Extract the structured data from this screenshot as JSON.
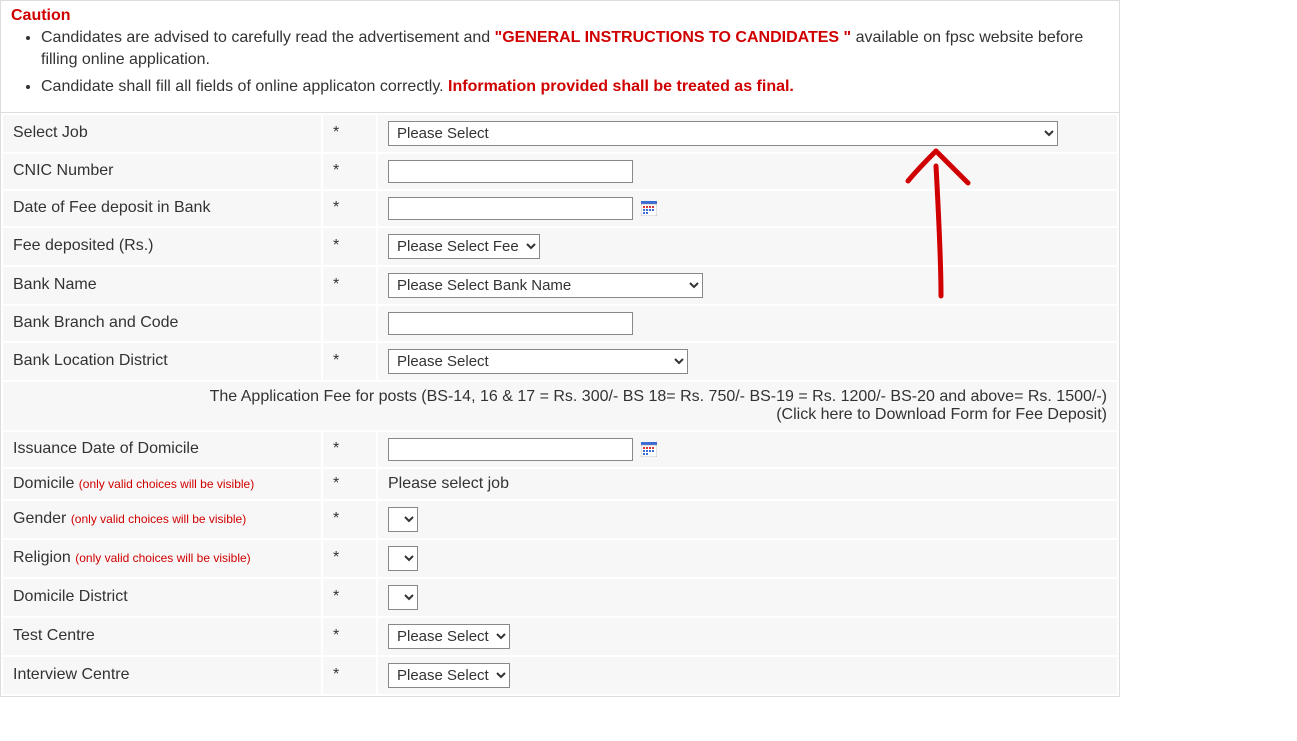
{
  "caution": {
    "title": "Caution",
    "item1_pre": "Candidates are advised to carefully read the advertisement and ",
    "item1_strong": "\"GENERAL INSTRUCTIONS TO CANDIDATES \"",
    "item1_post": " available on fpsc website before filling online application.",
    "item2_pre": "Candidate shall fill all fields of online applicaton correctly. ",
    "item2_strong": "Information provided shall be treated as final."
  },
  "fields": {
    "select_job": {
      "label": "Select Job",
      "star": "*",
      "option": "Please Select"
    },
    "cnic": {
      "label": "CNIC Number",
      "star": "*",
      "value": ""
    },
    "fee_date": {
      "label": "Date of Fee deposit in Bank",
      "star": "*",
      "value": ""
    },
    "fee_amount": {
      "label": "Fee deposited (Rs.)",
      "star": "*",
      "option": "Please Select Fee"
    },
    "bank_name": {
      "label": "Bank Name",
      "star": "*",
      "option": "Please Select Bank Name"
    },
    "bank_branch": {
      "label": "Bank Branch and Code",
      "star": "",
      "value": ""
    },
    "bank_loc": {
      "label": "Bank Location District",
      "star": "*",
      "option": "Please Select"
    },
    "fee_note_line1": "The Application Fee for posts (BS-14, 16 & 17 = Rs. 300/- BS 18= Rs. 750/- BS-19 = Rs. 1200/- BS-20 and above= Rs. 1500/-)",
    "fee_note_line2": "(Click here to Download Form for Fee Deposit)",
    "domicile_date": {
      "label": "Issuance Date of Domicile",
      "star": "*",
      "value": ""
    },
    "domicile": {
      "label": "Domicile ",
      "note": "(only valid choices will be visible)",
      "star": "*",
      "text": "Please select job"
    },
    "gender": {
      "label": "Gender ",
      "note": "(only valid choices will be visible)",
      "star": "*"
    },
    "religion": {
      "label": "Religion ",
      "note": "(only valid choices will be visible)",
      "star": "*"
    },
    "domicile_district": {
      "label": "Domicile District",
      "star": "*"
    },
    "test_centre": {
      "label": "Test Centre",
      "star": "*",
      "option": "Please Select"
    },
    "interview_centre": {
      "label": "Interview Centre",
      "star": "*",
      "option": "Please Select"
    }
  }
}
